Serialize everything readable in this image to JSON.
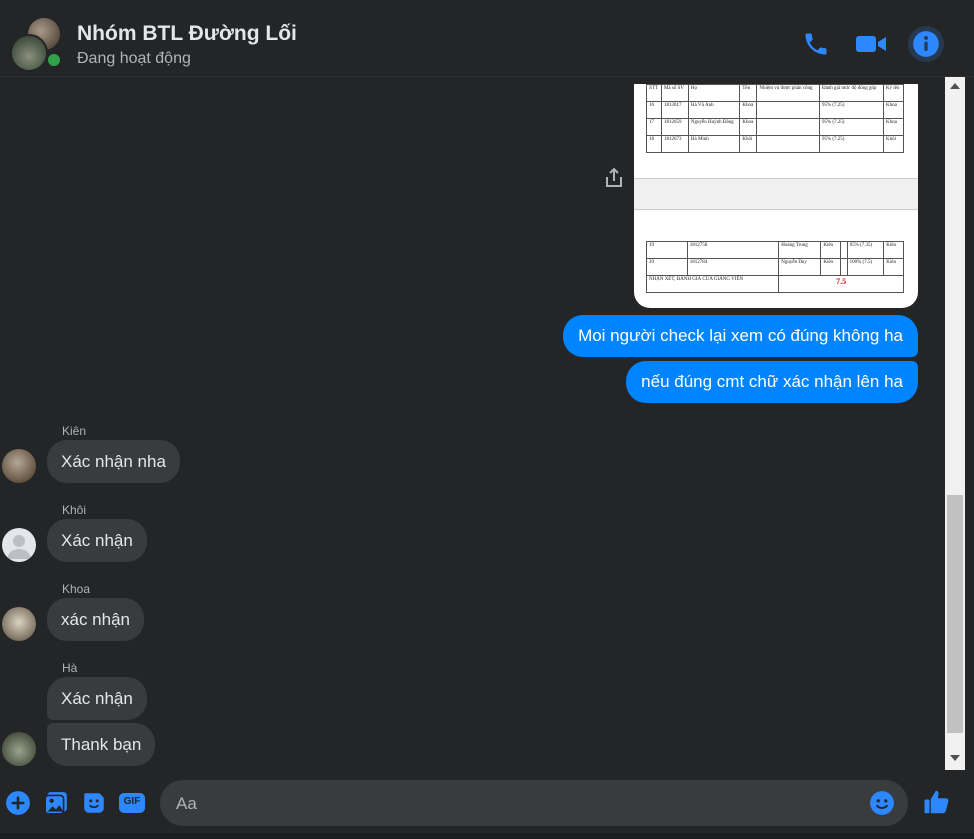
{
  "header": {
    "title": "Nhóm BTL Đường Lối",
    "status": "Đang hoạt động",
    "icons": [
      "phone-icon",
      "video-icon",
      "info-icon"
    ]
  },
  "colors": {
    "background": "#242526",
    "outgoing_bubble": "#0084ff",
    "incoming_bubble": "#3a3b3c",
    "accent": "#2d88ff",
    "online": "#31a24c"
  },
  "attachment": {
    "table_header": [
      "STT",
      "Mã số SV",
      "Họ",
      "Tên",
      "Nhiệm vụ được phân công",
      "Đánh giá mức độ đóng góp",
      "Ký tên"
    ],
    "rows_top": [
      [
        "16",
        "1813017",
        "Hà Vũ Anh",
        "Khoa",
        "",
        "95% (7.25)",
        "Khoa"
      ],
      [
        "17",
        "1812659",
        "Nguyễn Huỳnh Đăng",
        "Khoa",
        "",
        "95% (7.25)",
        "Khoa"
      ],
      [
        "18",
        "1812673",
        "Hà Minh",
        "Khôi",
        "",
        "95% (7.25)",
        "Khôi"
      ]
    ],
    "rows_bottom": [
      [
        "19",
        "1812758",
        "Hoàng Trung",
        "Kiên",
        "",
        "95% (7.35)",
        "Kiên"
      ],
      [
        "20",
        "1812784",
        "Nguyễn Duy",
        "Kiên",
        "",
        "100% (7.5)",
        "Kiên"
      ]
    ],
    "evaluation_label": "NHẬN XÉT, ĐÁNH GIÁ CỦA GIẢNG VIÊN",
    "score": "7.5"
  },
  "outgoing": [
    "Moi người check lại xem có đúng không ha",
    "nếu đúng cmt chữ xác nhận lên ha"
  ],
  "incoming": [
    {
      "sender": "Kiên",
      "messages": [
        "Xác nhận nha"
      ]
    },
    {
      "sender": "Khôi",
      "messages": [
        "Xác nhận"
      ]
    },
    {
      "sender": "Khoa",
      "messages": [
        "xác nhận"
      ]
    },
    {
      "sender": "Hà",
      "messages": [
        "Xác nhận",
        "Thank bạn"
      ]
    }
  ],
  "composer": {
    "placeholder": "Aa",
    "icons": [
      "plus-icon",
      "photo-icon",
      "sticker-icon",
      "gif-icon",
      "emoji-icon",
      "like-icon"
    ],
    "gif_label": "GIF"
  }
}
